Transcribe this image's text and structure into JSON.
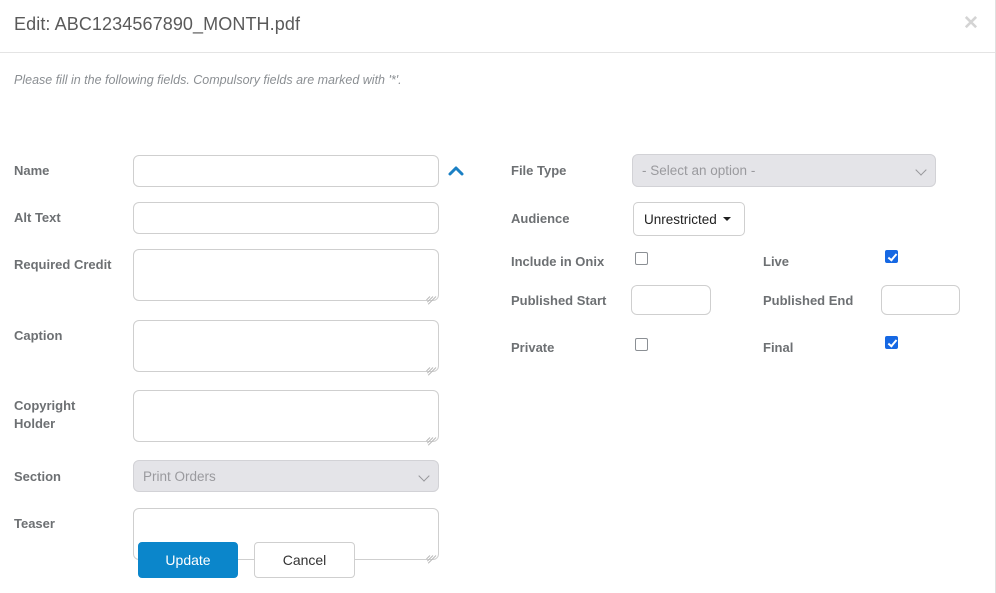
{
  "header": {
    "title": "Edit: ABC1234567890_MONTH.pdf",
    "close_label": "✕"
  },
  "instructions": "Please fill in the following fields. Compulsory fields are marked with '*'.",
  "left_column": {
    "name": {
      "label": "Name",
      "value": "",
      "placeholder": ""
    },
    "alt_text": {
      "label": "Alt Text",
      "value": "",
      "placeholder": ""
    },
    "required_credit": {
      "label": "Required Credit",
      "value": "",
      "placeholder": ""
    },
    "caption": {
      "label": "Caption",
      "value": "",
      "placeholder": ""
    },
    "copyright_holder": {
      "label": "Copyright Holder",
      "label_line1": "Copyright",
      "label_line2": "Holder",
      "value": "",
      "placeholder": ""
    },
    "section": {
      "label": "Section",
      "selected": "Print Orders",
      "options": [
        "Print Orders"
      ]
    },
    "teaser": {
      "label": "Teaser",
      "value": "",
      "placeholder": ""
    }
  },
  "right_column": {
    "file_type": {
      "label": "File Type",
      "selected": "- Select an option -",
      "options": [
        "- Select an option -"
      ]
    },
    "audience": {
      "label": "Audience",
      "selected": "Unrestricted"
    },
    "include_in_onix": {
      "label": "Include in Onix",
      "checked": false
    },
    "live": {
      "label": "Live",
      "checked": true
    },
    "published_start": {
      "label": "Published Start",
      "value": "",
      "placeholder": ""
    },
    "published_end": {
      "label": "Published End",
      "value": "",
      "placeholder": ""
    },
    "private": {
      "label": "Private",
      "checked": false
    },
    "final": {
      "label": "Final",
      "checked": true
    }
  },
  "actions": {
    "update_label": "Update",
    "cancel_label": "Cancel"
  },
  "colors": {
    "primary_button": "#0b86cb",
    "checkbox_checked": "#1668e3",
    "collapse_icon": "#1b80c4",
    "label_text": "#6d7073",
    "border": "#cfcfcf"
  }
}
